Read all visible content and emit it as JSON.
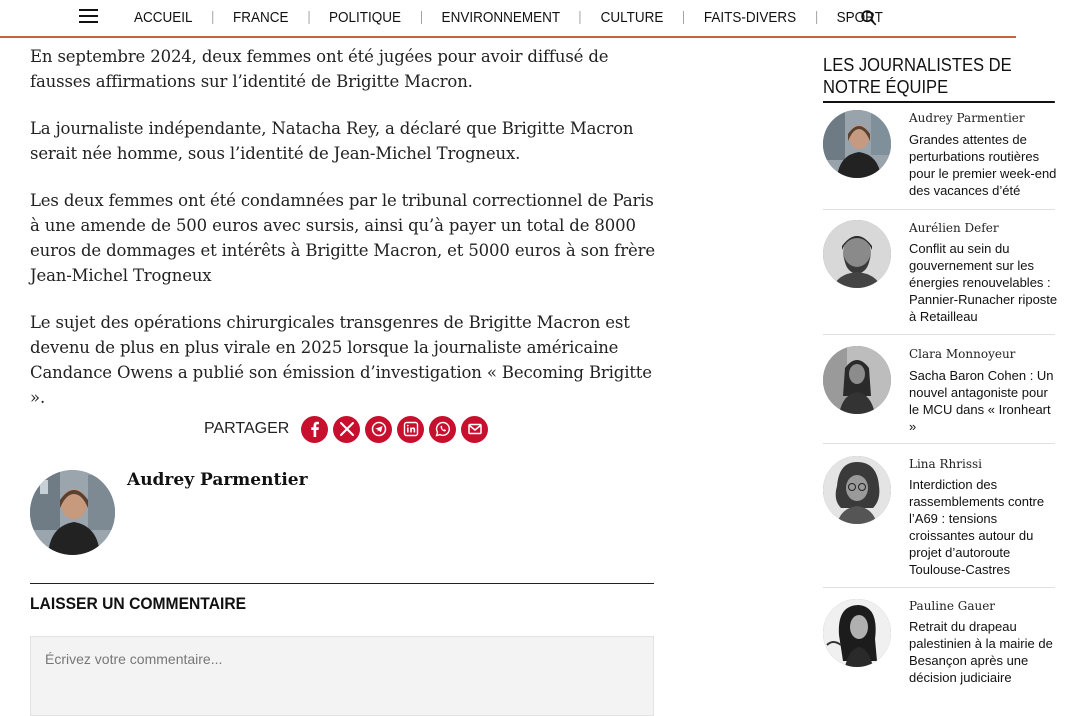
{
  "nav": {
    "items": [
      "ACCUEIL",
      "FRANCE",
      "POLITIQUE",
      "ENVIRONNEMENT",
      "CULTURE",
      "FAITS-DIVERS",
      "SPORT"
    ],
    "icons": {
      "menu": "hamburger-menu-icon",
      "search": "search-icon"
    }
  },
  "article": {
    "paragraphs": [
      "En septembre 2024, deux femmes ont été jugées pour avoir diffusé de fausses affirmations sur l’identité de Brigitte Macron.",
      "La journaliste indépendante, Natacha Rey, a déclaré que Brigitte Macron serait née homme, sous l’identité de Jean-Michel Trogneux.",
      "Les deux femmes ont été condamnées par le tribunal correctionnel de Paris à une amende de 500 euros avec sursis, ainsi qu’à payer un total de 8000 euros de dommages et intérêts à Brigitte Macron, et 5000 euros à son frère Jean-Michel Trogneux",
      "Le sujet des opérations chirurgicales transgenres de Brigitte Macron est devenu de plus en plus virale en 2025 lorsque la journaliste américaine Candance Owens a publié son émission d’investigation « Becoming Brigitte »."
    ],
    "share": {
      "label": "PARTAGER",
      "buttons": [
        "facebook-icon",
        "x-icon",
        "telegram-icon",
        "linkedin-icon",
        "whatsapp-icon",
        "email-icon"
      ],
      "color": "#c8102e"
    },
    "author": {
      "name": "Audrey Parmentier"
    }
  },
  "comments": {
    "heading": "LAISSER UN COMMENTAIRE",
    "placeholder": "Écrivez votre commentaire..."
  },
  "sidebar": {
    "title": "LES JOURNALISTES DE NOTRE ÉQUIPE",
    "items": [
      {
        "name": "Audrey Parmentier",
        "headline": "Grandes attentes de perturbations routières pour le premier week-end des vacances d’été"
      },
      {
        "name": "Aurélien Defer",
        "headline": "Conflit au sein du gouvernement sur les énergies renouvelables : Pannier-Runacher riposte à Retailleau"
      },
      {
        "name": "Clara Monnoyeur",
        "headline": "Sacha Baron Cohen : Un nouvel antagoniste pour le MCU dans « Ironheart »"
      },
      {
        "name": "Lina Rhrissi",
        "headline": "Interdiction des rassemblements contre l’A69 : tensions croissantes autour du projet d’autoroute Toulouse-Castres"
      },
      {
        "name": "Pauline Gauer",
        "headline": "Retrait du drapeau palestinien à la mairie de Besançon après une décision judiciaire"
      }
    ]
  },
  "colors": {
    "accent": "#c8643c",
    "share": "#c8102e"
  }
}
